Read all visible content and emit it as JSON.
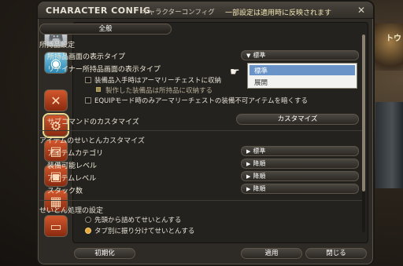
{
  "background": {
    "label": "トウ"
  },
  "window": {
    "title": "CHARACTER CONFIG",
    "subtitle": "キャラクターコンフィグ",
    "notice": "一部設定は適用時に反映されます"
  },
  "tabs": [
    "gamepad-icon",
    "planet-icon",
    "cross-swords-icon",
    "gear-icon",
    "card-icon",
    "portrait-icon",
    "bricks-icon",
    "chat-icon"
  ],
  "main": {
    "tab_label": "全般",
    "inventory": {
      "section": "所持品設定",
      "display_type_label": "所持品画面の表示タイプ",
      "display_type_value": "標準",
      "retainer_type_label": "リテイナー所持品画面の表示タイプ",
      "dropdown_options": [
        "標準",
        "展開"
      ],
      "armoury_check_label": "装備品入手時はアーマリーチェストに収納",
      "crafted_check_label": "製作した装備品は所持品に収納する",
      "equip_mode_label": "EQUIPモード時のみアーマリーチェストの装備不可アイテムを暗くする"
    },
    "subcommand": {
      "label": "サブコマンドのカスタマイズ",
      "button": "カスタマイズ"
    },
    "sort": {
      "section": "アイテムのせいとんカスタマイズ",
      "rows": [
        {
          "label": "アイテムカテゴリ",
          "value": "標準"
        },
        {
          "label": "装備可能レベル",
          "value": "降順"
        },
        {
          "label": "アイテムレベル",
          "value": "降順"
        },
        {
          "label": "スタック数",
          "value": "降順"
        }
      ]
    },
    "process": {
      "section": "せいとん処理の設定",
      "option1": "先頭から詰めてせいとんする",
      "option2": "タブ別に振り分けてせいとんする"
    }
  },
  "footer": {
    "reset": "初期化",
    "apply": "適用",
    "close": "閉じる"
  }
}
